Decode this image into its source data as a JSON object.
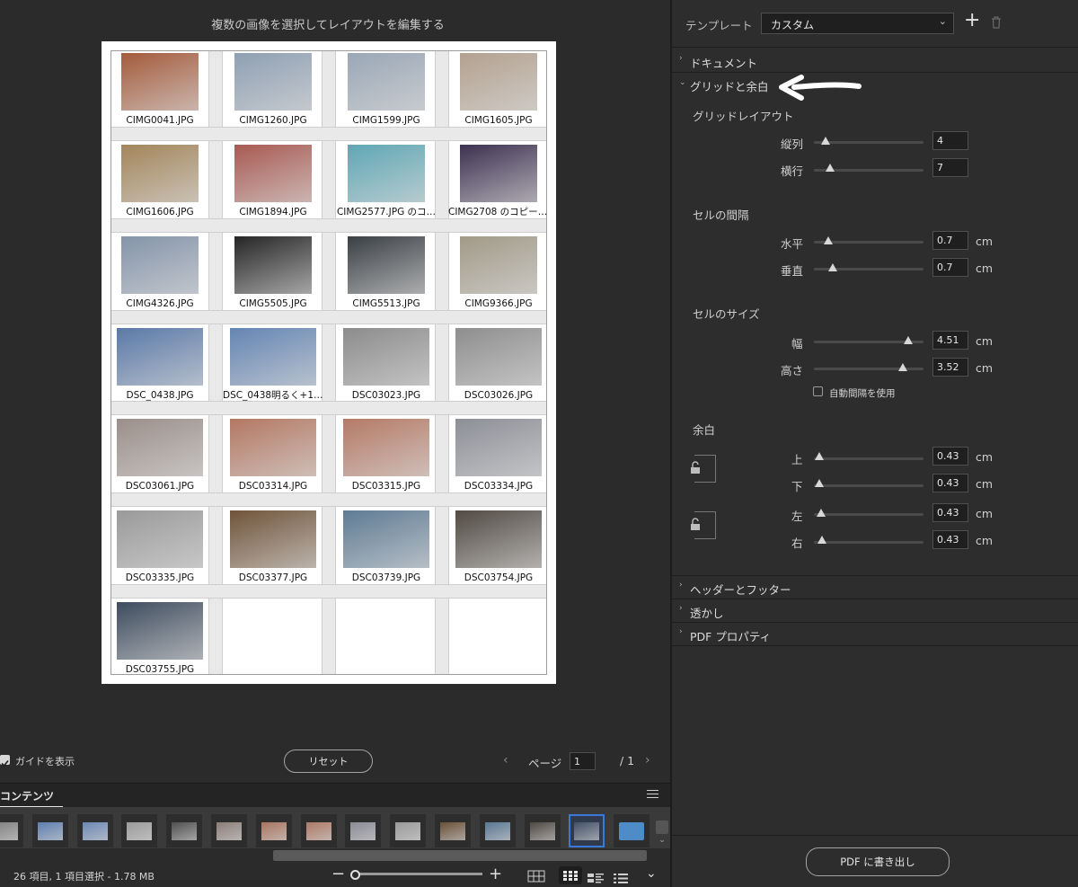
{
  "preview": {
    "title": "複数の画像を選択してレイアウトを編集する",
    "grid_items": [
      {
        "label": "CIMG0041.JPG",
        "color": "#a45b3c"
      },
      {
        "label": "CIMG1260.JPG",
        "color": "#8fa0b3"
      },
      {
        "label": "CIMG1599.JPG",
        "color": "#9aa7b6"
      },
      {
        "label": "CIMG1605.JPG",
        "color": "#b3a18f"
      },
      {
        "label": "CIMG1606.JPG",
        "color": "#a3855a"
      },
      {
        "label": "CIMG1894.JPG",
        "color": "#a85a52"
      },
      {
        "label": "CIMG2577.JPG のコ…",
        "color": "#5fa7b5"
      },
      {
        "label": "CIMG2708 のコピーJ…",
        "color": "#3d3150"
      },
      {
        "label": "CIMG4326.JPG",
        "color": "#8494aa"
      },
      {
        "label": "CIMG5505.JPG",
        "color": "#252525"
      },
      {
        "label": "CIMG5513.JPG",
        "color": "#3a3f44"
      },
      {
        "label": "CIMG9366.JPG",
        "color": "#a29a88"
      },
      {
        "label": "DSC_0438.JPG",
        "color": "#5a79a8"
      },
      {
        "label": "DSC_0438明るく+10…",
        "color": "#6485b3"
      },
      {
        "label": "DSC03023.JPG",
        "color": "#8c8c8c"
      },
      {
        "label": "DSC03026.JPG",
        "color": "#8e8e8e"
      },
      {
        "label": "DSC03061.JPG",
        "color": "#9b8f8a"
      },
      {
        "label": "DSC03314.JPG",
        "color": "#b37862"
      },
      {
        "label": "DSC03315.JPG",
        "color": "#b57a66"
      },
      {
        "label": "DSC03334.JPG",
        "color": "#8d8f97"
      },
      {
        "label": "DSC03335.JPG",
        "color": "#9a9a9a"
      },
      {
        "label": "DSC03377.JPG",
        "color": "#70543a"
      },
      {
        "label": "DSC03739.JPG",
        "color": "#5e7b94"
      },
      {
        "label": "DSC03754.JPG",
        "color": "#514a43"
      },
      {
        "label": "DSC03755.JPG",
        "color": "#3e4c5e"
      }
    ]
  },
  "controls": {
    "show_guides": "ガイドを表示",
    "reset": "リセット",
    "page_label": "ページ",
    "page_value": "1",
    "page_total": "/ 1"
  },
  "contents": {
    "title": "コンテンツ",
    "thumb_colors": [
      "#7f7f7f",
      "#5e7faf",
      "#6d88b5",
      "#9b9b9b",
      "#505050",
      "#8b7d78",
      "#a8745f",
      "#ad7a66",
      "#8a8b94",
      "#9a9a9a",
      "#6a5038",
      "#5a7792",
      "#4e4842",
      "#425067",
      "#4e8cc8"
    ],
    "status": "26 項目, 1 項目選択 - 1.78 MB"
  },
  "panel": {
    "template_label": "テンプレート",
    "template_value": "カスタム",
    "sections": {
      "document": "ドキュメント",
      "grid_margin": "グリッドと余白",
      "header_footer": "ヘッダーとフッター",
      "watermark": "透かし",
      "pdf_properties": "PDF プロパティ"
    },
    "grid_layout": {
      "title": "グリッドレイアウト",
      "columns_label": "縦列",
      "columns_value": "4",
      "rows_label": "横行",
      "rows_value": "7"
    },
    "cell_spacing": {
      "title": "セルの間隔",
      "horizontal_label": "水平",
      "horizontal_value": "0.7",
      "vertical_label": "垂直",
      "vertical_value": "0.7"
    },
    "cell_size": {
      "title": "セルのサイズ",
      "width_label": "幅",
      "width_value": "4.51",
      "height_label": "高さ",
      "height_value": "3.52",
      "auto_spacing": "自動間隔を使用"
    },
    "margins": {
      "title": "余白",
      "top_label": "上",
      "top_value": "0.43",
      "bottom_label": "下",
      "bottom_value": "0.43",
      "left_label": "左",
      "left_value": "0.43",
      "right_label": "右",
      "right_value": "0.43"
    },
    "unit": "cm",
    "export_button": "PDF に書き出し"
  }
}
